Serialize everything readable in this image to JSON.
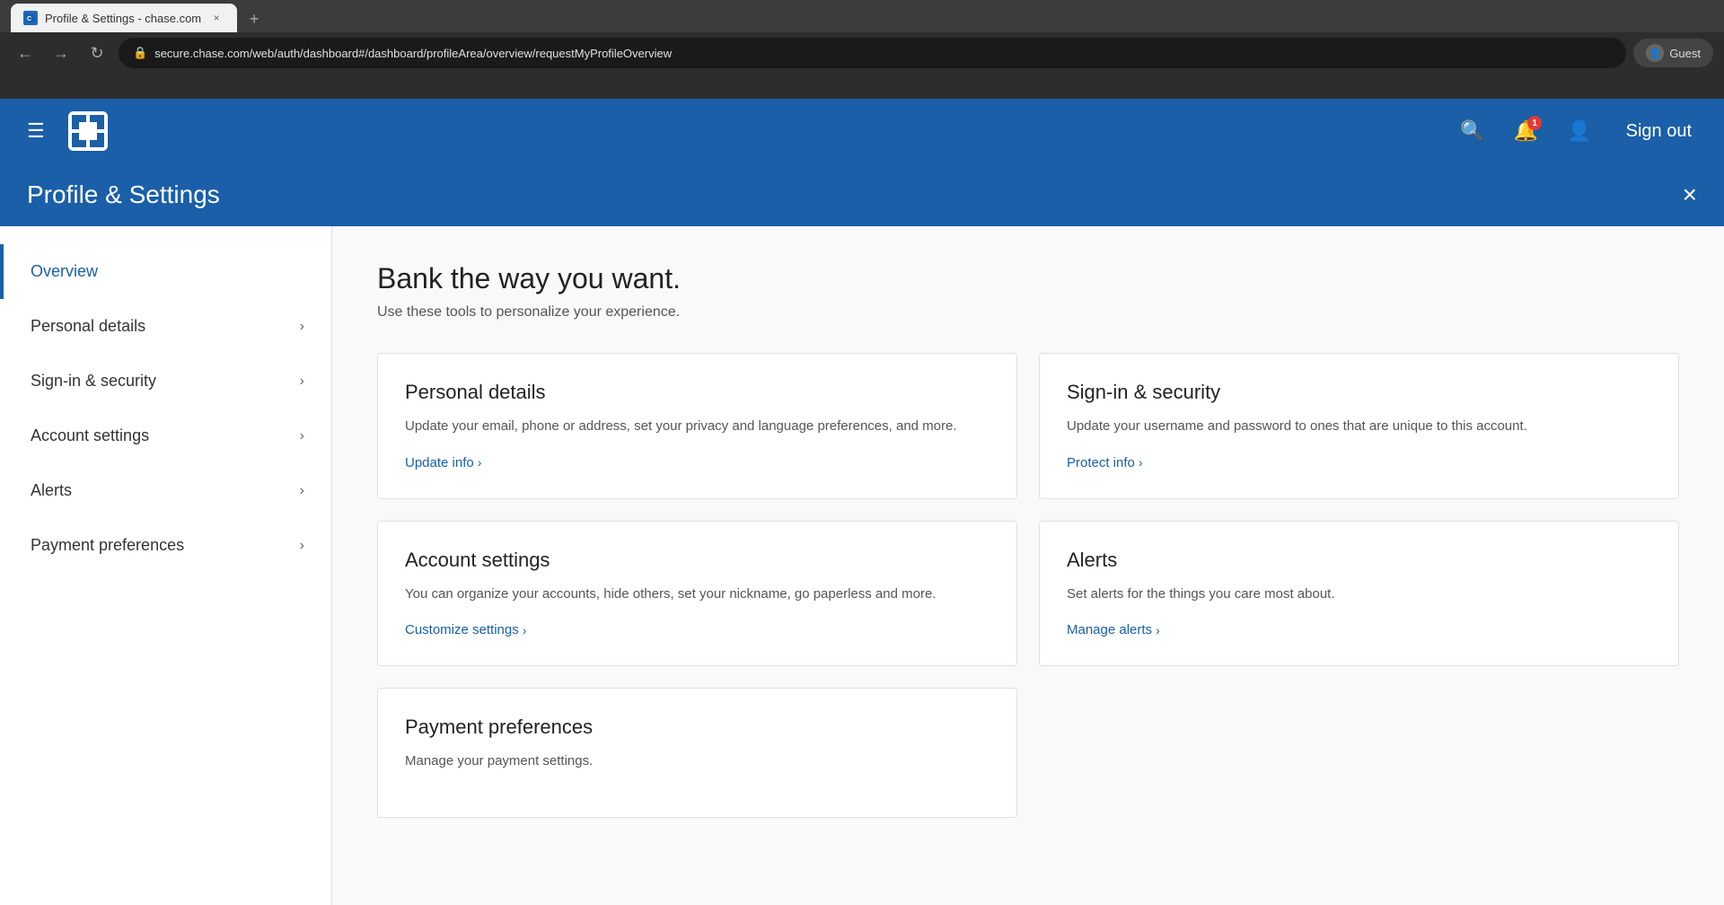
{
  "browser": {
    "tab_title": "Profile & Settings - chase.com",
    "tab_close_label": "×",
    "new_tab_label": "+",
    "address": "secure.chase.com/web/auth/dashboard#/dashboard/profileArea/overview/requestMyProfileOverview",
    "back_label": "←",
    "forward_label": "→",
    "refresh_label": "↻",
    "profile_label": "Guest"
  },
  "chase_header": {
    "sign_out_label": "Sign out",
    "notification_count": "1"
  },
  "profile_settings": {
    "banner_title": "Profile & Settings",
    "close_label": "×"
  },
  "sidebar": {
    "items": [
      {
        "label": "Overview",
        "active": true,
        "has_chevron": false
      },
      {
        "label": "Personal details",
        "active": false,
        "has_chevron": true
      },
      {
        "label": "Sign-in & security",
        "active": false,
        "has_chevron": true
      },
      {
        "label": "Account settings",
        "active": false,
        "has_chevron": true
      },
      {
        "label": "Alerts",
        "active": false,
        "has_chevron": true
      },
      {
        "label": "Payment preferences",
        "active": false,
        "has_chevron": true
      }
    ]
  },
  "content": {
    "heading": "Bank the way you want.",
    "subheading": "Use these tools to personalize your experience.",
    "cards": [
      {
        "id": "personal-details",
        "title": "Personal details",
        "description": "Update your email, phone or address, set your privacy and language preferences, and more.",
        "link_label": "Update info",
        "link_chevron": "›"
      },
      {
        "id": "sign-in-security",
        "title": "Sign-in & security",
        "description": "Update your username and password to ones that are unique to this account.",
        "link_label": "Protect info",
        "link_chevron": "›"
      },
      {
        "id": "account-settings",
        "title": "Account settings",
        "description": "You can organize your accounts, hide others, set your nickname, go paperless and more.",
        "link_label": "Customize settings",
        "link_chevron": "›"
      },
      {
        "id": "alerts",
        "title": "Alerts",
        "description": "Set alerts for the things you care most about.",
        "link_label": "Manage alerts",
        "link_chevron": "›"
      }
    ],
    "payment_card": {
      "title": "Payment preferences",
      "description": "Manage your payment settings."
    }
  }
}
